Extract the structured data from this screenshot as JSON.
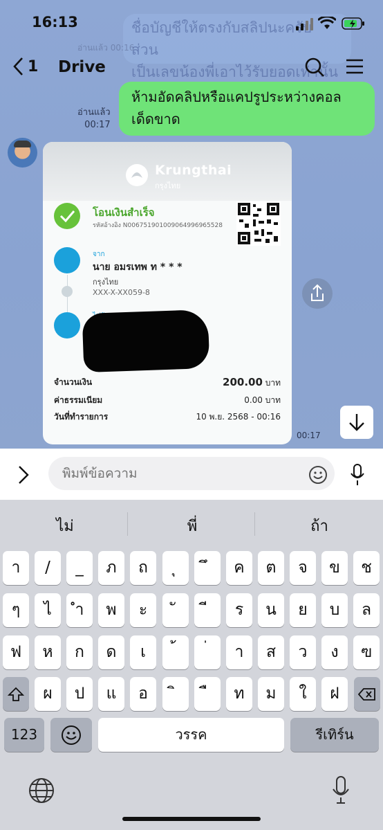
{
  "status": {
    "time": "16:13"
  },
  "nav": {
    "back_count": "1",
    "title": "Drive"
  },
  "ghost_message": {
    "line1": "ชื่อบัญชีให้ตรงกับสลิปนะครับ ส่วน",
    "line2": "เป็นเลขน้องพี่เอาไว้รับยอดเท่านั้น",
    "meta": "อ่านแล้ว 00:16"
  },
  "outgoing": {
    "line1": "ห้ามอัดคลิปหรือแคปรูประหว่างคอล",
    "line2": "เด็ดขาด",
    "read": "อ่านแล้ว",
    "time": "00:17"
  },
  "slip": {
    "brand": "Krungthai",
    "brand_th": "กรุงไทย",
    "status": "โอนเงินสำเร็จ",
    "ref": "รหัสอ้างอิง N006751901009064996965528",
    "from_label": "จาก",
    "from_name": "นาย อมรเทพ ท * * *",
    "from_bank": "กรุงไทย",
    "from_acct": "XXX-X-XX059-8",
    "to_label": "ไปยัง",
    "amount_label": "จำนวนเงิน",
    "amount_value": "200.00",
    "fee_label": "ค่าธรรมเนียม",
    "fee_value": "0.00",
    "currency": "บาท",
    "date_label": "วันที่ทำรายการ",
    "date_value": "10 พ.ย. 2568 - 00:16",
    "time": "00:17"
  },
  "input": {
    "placeholder": "พิมพ์ข้อความ"
  },
  "suggestions": [
    "ไม่",
    "พี่",
    "ถ้า"
  ],
  "keys": {
    "row1": [
      "า",
      "/",
      "_",
      "ภ",
      "ถ",
      "ุ",
      "ึ",
      "ค",
      "ต",
      "จ",
      "ข",
      "ช"
    ],
    "row2": [
      "ๆ",
      "ไ",
      "ำ",
      "พ",
      "ะ",
      "ั",
      "ี",
      "ร",
      "น",
      "ย",
      "บ",
      "ล"
    ],
    "row3": [
      "ฟ",
      "ห",
      "ก",
      "ด",
      "เ",
      "้",
      "่",
      "า",
      "ส",
      "ว",
      "ง",
      "ฃ"
    ],
    "row4": [
      "ผ",
      "ป",
      "แ",
      "อ",
      "ิ",
      "ื",
      "ท",
      "ม",
      "ใ",
      "ฝ"
    ],
    "numbers": "123",
    "space": "วรรค",
    "return": "รีเทิร์น"
  },
  "colors": {
    "accent_green": "#6fe378",
    "krungthai_blue": "#1ba1db",
    "success_green": "#67c23a"
  }
}
